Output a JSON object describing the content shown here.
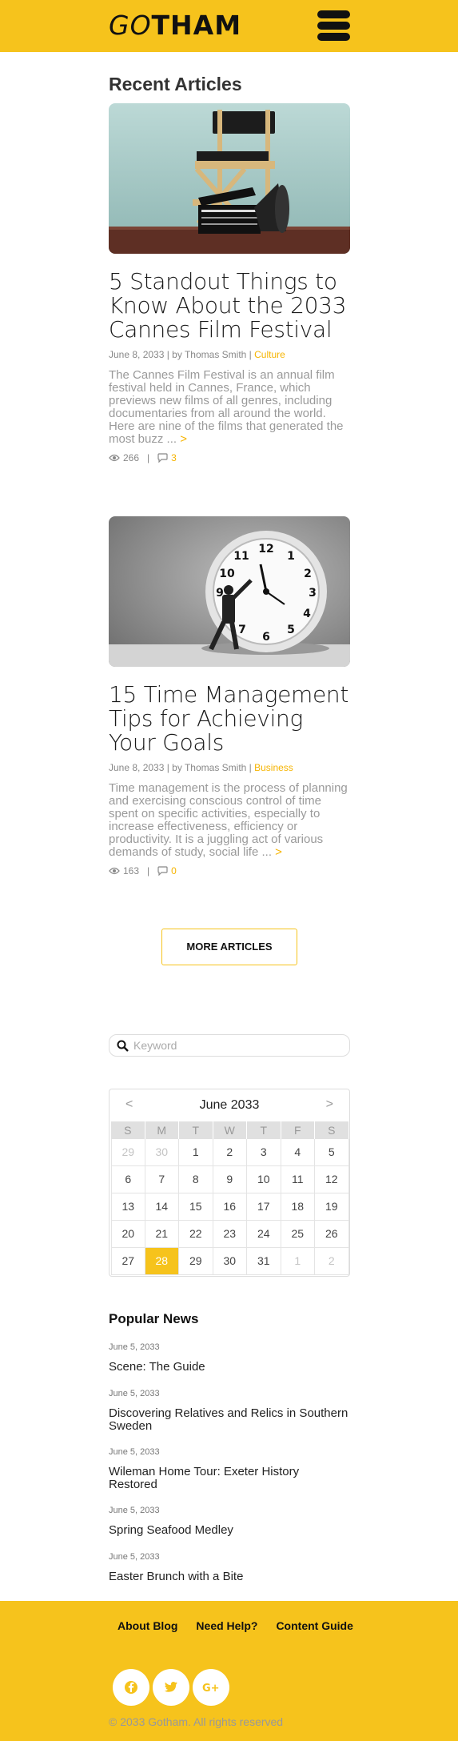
{
  "header": {
    "logo_go": "GO",
    "logo_rest": "THAM",
    "menu_icon": "hamburger-menu-icon",
    "brand_color": "#f6c31c"
  },
  "recent": {
    "title": "Recent Articles",
    "articles": [
      {
        "title": "5 Standout Things to Know About the 2033 Cannes Film Festival",
        "meta": "June 8, 2033 | by Thomas Smith | ",
        "category": "Culture",
        "excerpt": "The Cannes Film Festival is an annual film festival held in Cannes, France, which previews new films of all genres, including documentaries from all around the world. Here are nine of the films that generated the most buzz ... ",
        "more": ">",
        "views": "266",
        "comments": "3"
      },
      {
        "title": "15 Time Management Tips for Achieving Your Goals",
        "meta": "June 8, 2033 | by Thomas Smith | ",
        "category": "Business",
        "excerpt": "Time management is the process of planning and exercising conscious control of time spent on specific activities, especially to increase effectiveness, efficiency or productivity. It is a juggling act of various demands of study, social life ... ",
        "more": ">",
        "views": "163",
        "comments": "0"
      }
    ],
    "stats_separator": "|",
    "more_button": "MORE ARTICLES"
  },
  "search": {
    "placeholder": "Keyword"
  },
  "calendar": {
    "prev": "<",
    "next": ">",
    "month": "June 2033",
    "dows": [
      "S",
      "M",
      "T",
      "W",
      "T",
      "F",
      "S"
    ],
    "weeks": [
      [
        {
          "d": "29",
          "o": true
        },
        {
          "d": "30",
          "o": true
        },
        {
          "d": "1"
        },
        {
          "d": "2"
        },
        {
          "d": "3"
        },
        {
          "d": "4"
        },
        {
          "d": "5"
        }
      ],
      [
        {
          "d": "6"
        },
        {
          "d": "7"
        },
        {
          "d": "8"
        },
        {
          "d": "9"
        },
        {
          "d": "10"
        },
        {
          "d": "11"
        },
        {
          "d": "12"
        }
      ],
      [
        {
          "d": "13"
        },
        {
          "d": "14"
        },
        {
          "d": "15"
        },
        {
          "d": "16"
        },
        {
          "d": "17"
        },
        {
          "d": "18"
        },
        {
          "d": "19"
        }
      ],
      [
        {
          "d": "20"
        },
        {
          "d": "21"
        },
        {
          "d": "22"
        },
        {
          "d": "23"
        },
        {
          "d": "24"
        },
        {
          "d": "25"
        },
        {
          "d": "26"
        }
      ],
      [
        {
          "d": "27"
        },
        {
          "d": "28",
          "t": true
        },
        {
          "d": "29"
        },
        {
          "d": "30"
        },
        {
          "d": "31"
        },
        {
          "d": "1",
          "o": true
        },
        {
          "d": "2",
          "o": true
        }
      ]
    ]
  },
  "popular": {
    "title": "Popular News",
    "items": [
      {
        "date": "June 5, 2033",
        "title": "Scene: The Guide"
      },
      {
        "date": "June 5, 2033",
        "title": "Discovering Relatives and Relics in Southern Sweden"
      },
      {
        "date": "June 5, 2033",
        "title": "Wileman Home Tour: Exeter History Restored"
      },
      {
        "date": "June 5, 2033",
        "title": "Spring Seafood Medley"
      },
      {
        "date": "June 5, 2033",
        "title": "Easter Brunch with a Bite"
      }
    ]
  },
  "footer": {
    "links": [
      "About Blog",
      "Need Help?",
      "Content Guide"
    ],
    "social": [
      "facebook-icon",
      "twitter-icon",
      "google-plus-icon"
    ],
    "copyright": "© 2033 Gotham. All rights reserved"
  }
}
